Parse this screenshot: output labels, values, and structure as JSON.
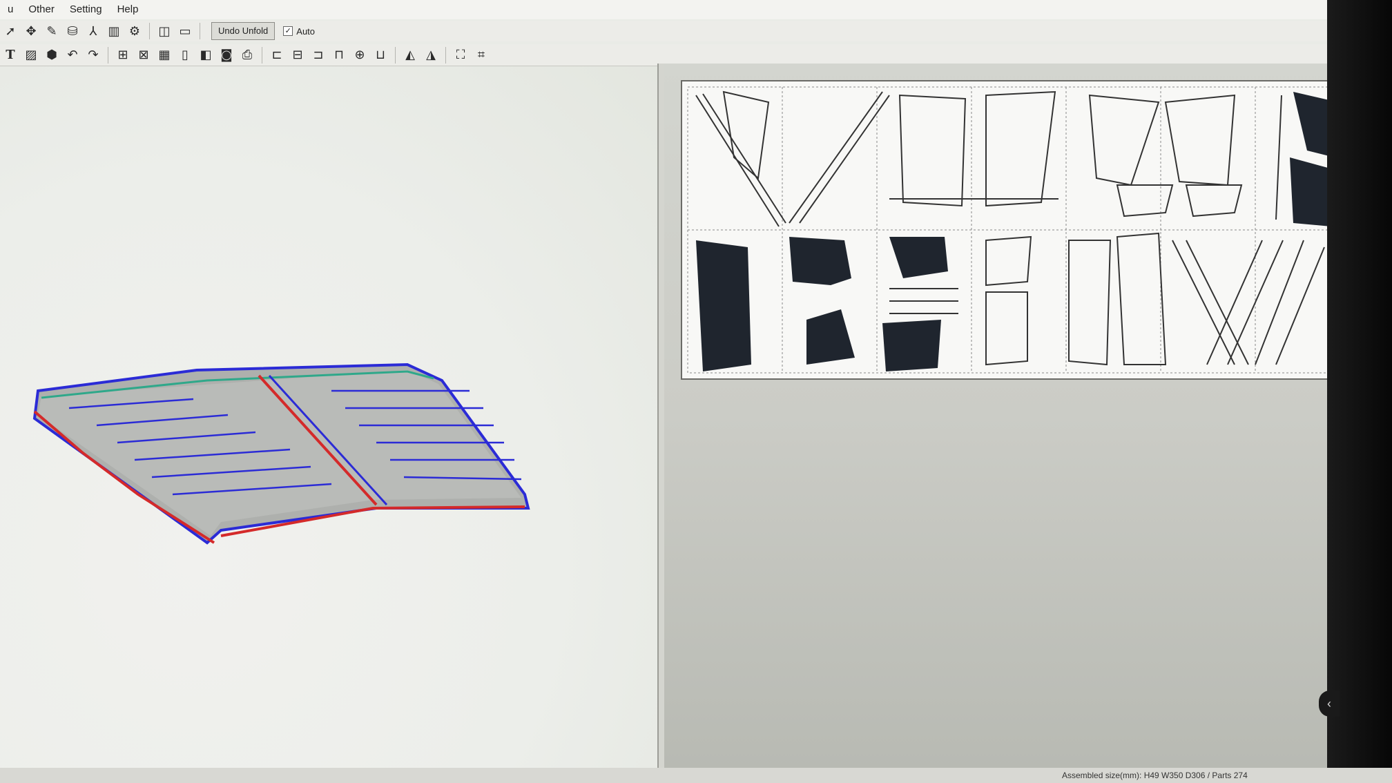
{
  "menu": {
    "items": [
      "u",
      "Other",
      "Setting",
      "Help"
    ]
  },
  "toolbar": {
    "undo_unfold_label": "Undo Unfold",
    "auto_label": "Auto",
    "auto_checked_mark": "✓",
    "row1_icons": [
      "select-pointer-icon",
      "rotate-tool-icon",
      "paint-bucket-icon",
      "cylinder-icon",
      "axis-icon",
      "split-view-icon",
      "link-icon",
      "two-pane-icon",
      "single-pane-icon"
    ],
    "row2_icons": [
      "text-tool-icon",
      "image-tool-icon",
      "cube-icon",
      "undo-icon",
      "redo-icon",
      "book-icon",
      "layout-icon",
      "grid-icon",
      "page-icon",
      "page-flip-icon",
      "camera-icon",
      "print-icon",
      "align-left-icon",
      "align-center-icon",
      "align-right-icon",
      "align-top-icon",
      "align-middle-icon",
      "align-bottom-icon",
      "flip-horizontal-icon",
      "flip-vertical-icon",
      "fit-page-icon",
      "select-all-icon"
    ]
  },
  "status": {
    "assembled_size": "Assembled size(mm): H49 W350 D306 / Parts 274"
  },
  "colors": {
    "model_outline": "#2b2bd6",
    "model_cut_edge": "#d42a2a",
    "model_fold_edge": "#2fa88a",
    "part_fill": "#1f252e"
  }
}
